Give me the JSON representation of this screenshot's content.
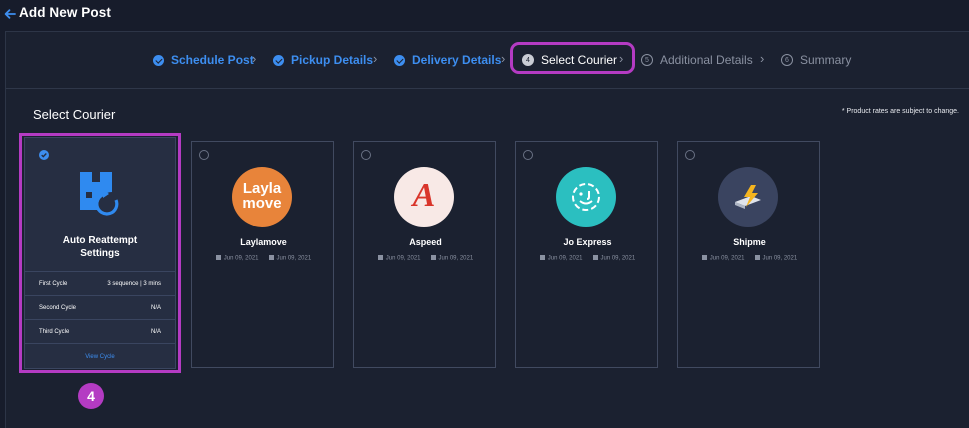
{
  "header": {
    "title": "Add New Post"
  },
  "stepper": {
    "steps": [
      {
        "label": "Schedule Post",
        "state": "done"
      },
      {
        "label": "Pickup Details",
        "state": "done"
      },
      {
        "label": "Delivery Details",
        "state": "done"
      },
      {
        "label": "Select Courier",
        "state": "active",
        "number": "4"
      },
      {
        "label": "Additional Details",
        "state": "todo",
        "number": "5"
      },
      {
        "label": "Summary",
        "state": "todo",
        "number": "6"
      }
    ]
  },
  "section": {
    "title": "Select Courier",
    "note": "* Product rates are subject to change."
  },
  "auto_reattempt": {
    "title_line1": "Auto Reattempt",
    "title_line2": "Settings",
    "cycles": [
      {
        "label": "First Cycle",
        "value": "3 sequence | 3 mins"
      },
      {
        "label": "Second Cycle",
        "value": "N/A"
      },
      {
        "label": "Third Cycle",
        "value": "N/A"
      }
    ],
    "view_cycle": "View Cycle"
  },
  "couriers": [
    {
      "name": "Laylamove",
      "date1": "Jun 09, 2021",
      "date2": "Jun 09, 2021",
      "logo_text1": "Layla",
      "logo_text2": "move",
      "logo_bg": "#e8843a"
    },
    {
      "name": "Aspeed",
      "date1": "Jun 09, 2021",
      "date2": "Jun 09, 2021",
      "logo_text": "A",
      "logo_bg": "#f8e9e6"
    },
    {
      "name": "Jo Express",
      "date1": "Jun 09, 2021",
      "date2": "Jun 09, 2021",
      "logo_bg": "#2bbfc0"
    },
    {
      "name": "Shipme",
      "date1": "Jun 09, 2021",
      "date2": "Jun 09, 2021",
      "logo_bg": "#3a4460"
    }
  ],
  "annotation": {
    "badge": "4"
  },
  "colors": {
    "accent": "#3d8ef0",
    "highlight": "#b43bc3",
    "background": "#171c2b"
  }
}
